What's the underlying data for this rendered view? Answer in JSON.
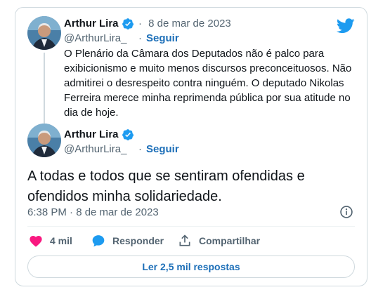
{
  "quoted_tweet": {
    "author_name": "Arthur Lira",
    "date_separator": "·",
    "date": "8 de mar de 2023",
    "handle": "@ArthurLira_",
    "handle_separator": "·",
    "follow_label": "Seguir",
    "text": "O Plenário da Câmara dos Deputados não é palco para exibicionismo e muito menos discursos preconceituosos. Não admitirei o desrespeito contra ninguém. O deputado Nikolas Ferreira merece minha reprimenda pública por sua atitude no dia de hoje."
  },
  "main_tweet": {
    "author_name": "Arthur Lira",
    "handle": "@ArthurLira_",
    "handle_separator": "·",
    "follow_label": "Seguir",
    "text": "A todas e todos que se sentiram ofendidas e ofendidos minha solidariedade.",
    "timestamp": "6:38 PM · 8 de mar de 2023"
  },
  "actions": {
    "likes_label": "4 mil",
    "reply_label": "Responder",
    "share_label": "Compartilhar"
  },
  "replies_button_label": "Ler 2,5 mil respostas",
  "colors": {
    "twitter_blue": "#1d9bf0",
    "like_pink": "#f91880",
    "link_blue": "#1d6fb8",
    "muted_text": "#536471",
    "border": "#cfd9de"
  },
  "icons": {
    "brand": "twitter-bird-icon",
    "verified": "verified-badge-icon",
    "info": "info-icon",
    "like": "heart-icon",
    "reply": "speech-bubble-icon",
    "share": "share-upload-icon"
  }
}
